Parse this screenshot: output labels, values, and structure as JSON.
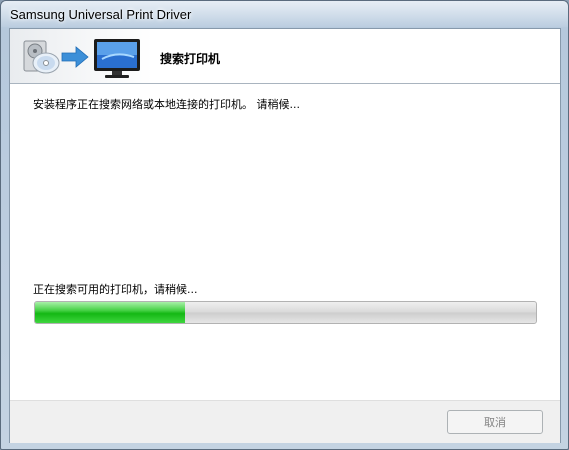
{
  "window": {
    "title": "Samsung Universal Print Driver"
  },
  "header": {
    "title": "搜索打印机",
    "icon": "install-to-monitor-icon"
  },
  "status": {
    "main_message": "安装程序正在搜索网络或本地连接的打印机。 请稍候...",
    "progress_message": "正在搜索可用的打印机，请稍候..."
  },
  "progress": {
    "fraction": 0.3
  },
  "footer": {
    "cancel_label": "取消",
    "cancel_enabled": false
  },
  "colors": {
    "progress_fill": "#1fbf1f",
    "progress_track": "#d9d9d9"
  }
}
